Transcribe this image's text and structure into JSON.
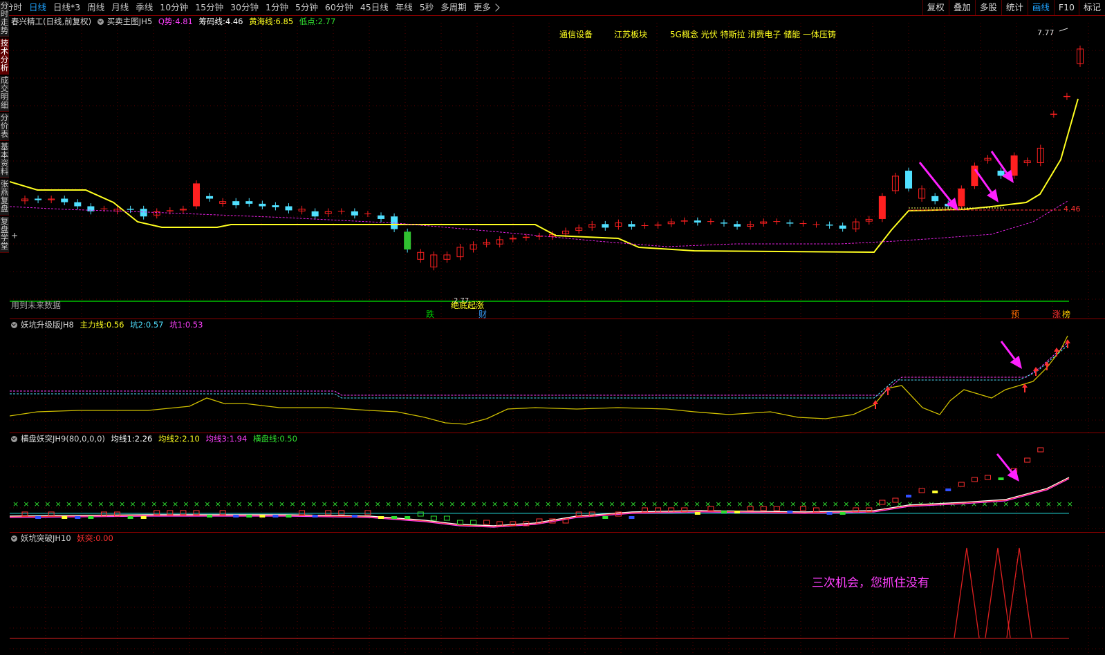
{
  "top_tabs": [
    {
      "label": "分时",
      "active": false
    },
    {
      "label": "日线",
      "active": true
    },
    {
      "label": "日线*3",
      "active": false
    },
    {
      "label": "周线",
      "active": false
    },
    {
      "label": "月线",
      "active": false
    },
    {
      "label": "季线",
      "active": false
    },
    {
      "label": "10分钟",
      "active": false
    },
    {
      "label": "15分钟",
      "active": false
    },
    {
      "label": "30分钟",
      "active": false
    },
    {
      "label": "1分钟",
      "active": false
    },
    {
      "label": "5分钟",
      "active": false
    },
    {
      "label": "60分钟",
      "active": false
    },
    {
      "label": "45日线",
      "active": false
    },
    {
      "label": "年线",
      "active": false
    },
    {
      "label": "5秒",
      "active": false
    },
    {
      "label": "多周期",
      "active": false
    }
  ],
  "more_label": "更多",
  "right_buttons": [
    "复权",
    "叠加",
    "多股",
    "统计",
    "画线",
    "F10",
    "标记"
  ],
  "right_active": "画线",
  "left_tabs": [
    "分时走势",
    "技术分析",
    "成交明细",
    "分价表",
    "基本资料",
    "张燕复盘",
    "复盘学堂"
  ],
  "left_active": "技术分析",
  "main": {
    "stock": "春兴精工(日线,前复权)",
    "indicator": "买卖主图JH5",
    "q_label": "Q势:",
    "q_value": "4.81",
    "chip_label": "筹码线:",
    "chip_value": "4.46",
    "yellow_label": "黄海线:",
    "yellow_value": "6.85",
    "low_label": "低点:",
    "low_value": "2.77",
    "sectors": [
      "通信设备",
      "江苏板块",
      "5G概念 光伏 特斯拉 消费电子 储能 一体压铸"
    ],
    "high_price": "7.77",
    "low_price_label": "2.77",
    "bottom_text": "绝底起涨",
    "ref_price": "4.46",
    "future_text": "用到未来数据",
    "markers": [
      {
        "text": "跌",
        "color": "#00d000"
      },
      {
        "text": "财",
        "color": "#3aa0ff"
      },
      {
        "text": "预",
        "color": "#ff6a00"
      },
      {
        "text": "涨",
        "color": "#ff3030"
      },
      {
        "text": "榜",
        "color": "#ffcc00"
      }
    ]
  },
  "pane2": {
    "name": "妖坑升级版JH8",
    "l1": "主力线:",
    "v1": "0.56",
    "l2": "坑2:",
    "v2": "0.57",
    "l3": "坑1:",
    "v3": "0.53"
  },
  "pane3": {
    "name": "横盘妖突JH9(80,0,0,0)",
    "l1": "均线1:",
    "v1": "2.26",
    "l2": "均线2:",
    "v2": "2.10",
    "l3": "均线3:",
    "v3": "1.94",
    "l4": "横盘线:",
    "v4": "0.50"
  },
  "pane4": {
    "name": "妖坑突破JH10",
    "l1": "妖突:",
    "v1": "0.00",
    "slogan": "三次机会，您抓住没有"
  },
  "colors": {
    "up": "#ff2020",
    "down": "#50e0ff",
    "ma_yellow": "#ffff20",
    "ma_magenta": "#e020e0",
    "green": "#00c000",
    "arrow": "#ff20ff"
  }
}
